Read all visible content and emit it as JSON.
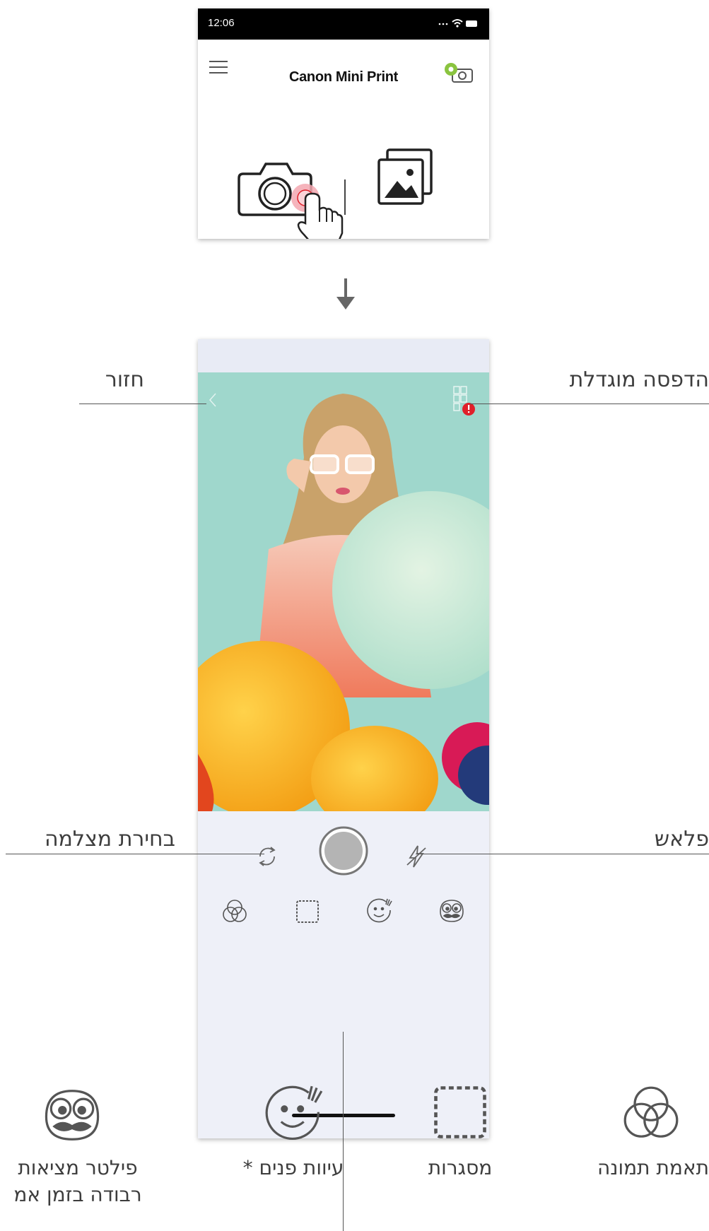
{
  "status_bar": {
    "time": "12:06",
    "icons": "····  ◉ ▬"
  },
  "app": {
    "title": "Canon Mini Print"
  },
  "callouts": {
    "back": "חזור",
    "enlarged_print": "הדפסה מוגדלת",
    "switch_camera": "בחירת מצלמה",
    "flash": "פלאש"
  },
  "features": [
    {
      "label": "פילטר מציאות",
      "label2": "רבודה בזמן אמ",
      "icon": "mustache-face-icon"
    },
    {
      "label": "עיוות פנים *",
      "icon": "face-warp-icon"
    },
    {
      "label": "מסגרות",
      "icon": "frame-icon"
    },
    {
      "label": "תאמת תמונה",
      "icon": "color-overlap-icon"
    }
  ],
  "badge": {
    "count": "!"
  },
  "colors": {
    "accent_red": "#e0202a",
    "printer_green": "#8ac43f",
    "preview_bg": "#9fd7cc"
  }
}
